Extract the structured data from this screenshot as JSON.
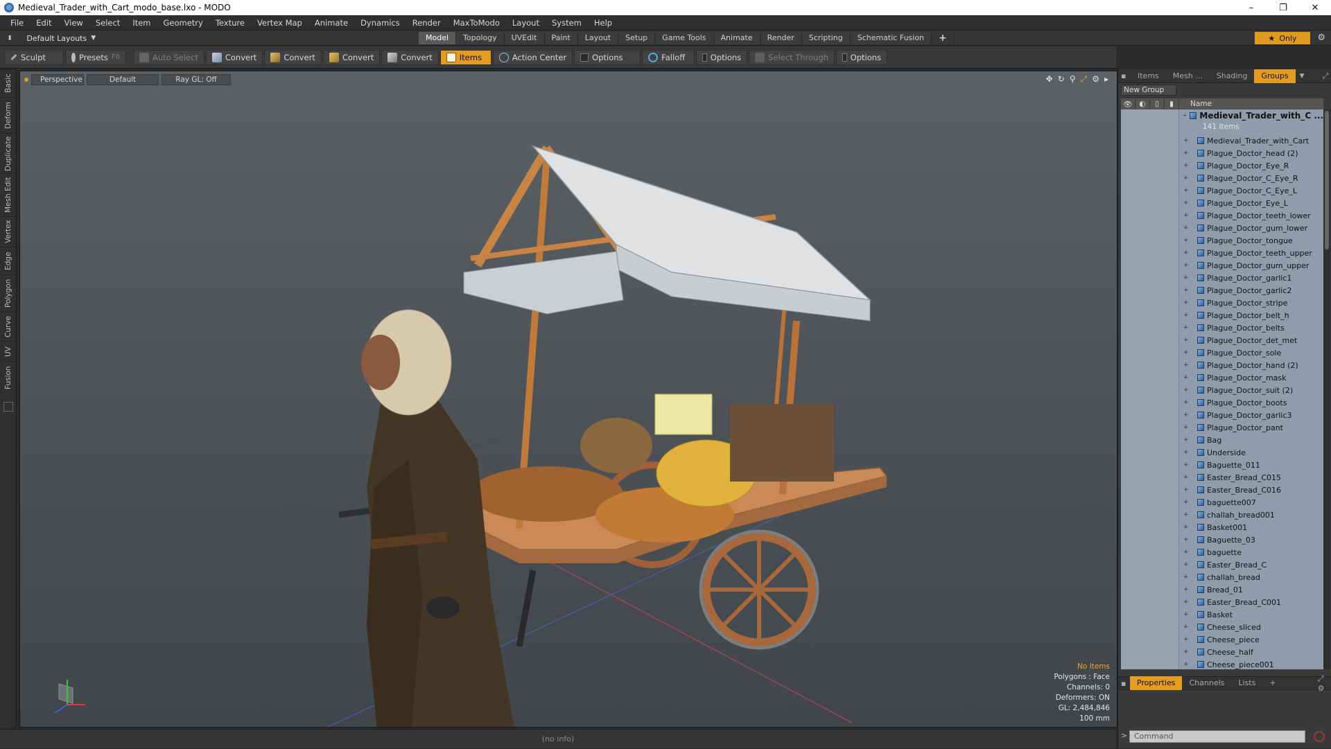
{
  "window": {
    "title": "Medieval_Trader_with_Cart_modo_base.lxo - MODO",
    "controls": [
      "–",
      "❐",
      "✕"
    ]
  },
  "menubar": [
    "File",
    "Edit",
    "View",
    "Select",
    "Item",
    "Geometry",
    "Texture",
    "Vertex Map",
    "Animate",
    "Dynamics",
    "Render",
    "MaxToModo",
    "Layout",
    "System",
    "Help"
  ],
  "layouts": {
    "label": "Default Layouts"
  },
  "tabs": [
    {
      "label": "Model",
      "active": true
    },
    {
      "label": "Topology"
    },
    {
      "label": "UVEdit"
    },
    {
      "label": "Paint"
    },
    {
      "label": "Layout"
    },
    {
      "label": "Setup"
    },
    {
      "label": "Game Tools"
    },
    {
      "label": "Animate"
    },
    {
      "label": "Render"
    },
    {
      "label": "Scripting"
    },
    {
      "label": "Schematic Fusion"
    }
  ],
  "tab_add": "+",
  "only_label": "Only",
  "toolbar": {
    "sculpt": "Sculpt",
    "presets": "Presets",
    "presets_key": "F6",
    "auto_select": "Auto Select",
    "convert1": "Convert",
    "convert2": "Convert",
    "convert3": "Convert",
    "convert4": "Convert",
    "items": "Items",
    "action_center": "Action Center",
    "options1": "Options",
    "falloff": "Falloff",
    "options2": "Options",
    "select_through": "Select Through",
    "options3": "Options"
  },
  "left_tabs": [
    "Basic",
    "Deform",
    "Duplicate",
    "Mesh Edit",
    "Vertex",
    "Edge",
    "Polygon",
    "Curve",
    "UV",
    "Fusion"
  ],
  "viewport": {
    "view": "Perspective",
    "shading": "Default",
    "raygl": "Ray GL: Off",
    "info": {
      "no_items": "No Items",
      "polygons": "Polygons : Face",
      "channels": "Channels: 0",
      "deformers": "Deformers: ON",
      "gl": "GL: 2,484,846",
      "scale": "100 mm"
    }
  },
  "status": "(no info)",
  "right_panel": {
    "tabs": [
      {
        "label": "Items"
      },
      {
        "label": "Mesh ..."
      },
      {
        "label": "Shading"
      },
      {
        "label": "Groups",
        "active": true
      }
    ],
    "new_group": "New Group",
    "column_name": "Name",
    "root_name": "Medieval_Trader_with_C ...",
    "root_count": "141 Items",
    "items": [
      "Medieval_Trader_with_Cart",
      "Plague_Doctor_head (2)",
      "Plague_Doctor_Eye_R",
      "Plague_Doctor_C_Eye_R",
      "Plague_Doctor_C_Eye_L",
      "Plague_Doctor_Eye_L",
      "Plague_Doctor_teeth_lower",
      "Plague_Doctor_gum_lower",
      "Plague_Doctor_tongue",
      "Plague_Doctor_teeth_upper",
      "Plague_Doctor_gum_upper",
      "Plague_Doctor_garlic1",
      "Plague_Doctor_garlic2",
      "Plague_Doctor_stripe",
      "Plague_Doctor_belt_h",
      "Plague_Doctor_belts",
      "Plague_Doctor_det_met",
      "Plague_Doctor_sole",
      "Plague_Doctor_hand (2)",
      "Plague_Doctor_mask",
      "Plague_Doctor_suit (2)",
      "Plague_Doctor_boots",
      "Plague_Doctor_garlic3",
      "Plague_Doctor_pant",
      "Bag",
      "Underside",
      "Baguette_011",
      "Easter_Bread_C015",
      "Easter_Bread_C016",
      "baguette007",
      "challah_bread001",
      "Basket001",
      "Baguette_03",
      "baguette",
      "Easter_Bread_C",
      "challah_bread",
      "Bread_01",
      "Easter_Bread_C001",
      "Basket",
      "Cheese_sliced",
      "Cheese_piece",
      "Cheese_half",
      "Cheese_piece001"
    ],
    "bottom_tabs": [
      {
        "label": "Properties",
        "active": true
      },
      {
        "label": "Channels"
      },
      {
        "label": "Lists"
      },
      {
        "label": "+"
      }
    ],
    "command_placeholder": "Command"
  },
  "colors": {
    "accent": "#e39b21",
    "tree_bg": "#8f9cab"
  }
}
